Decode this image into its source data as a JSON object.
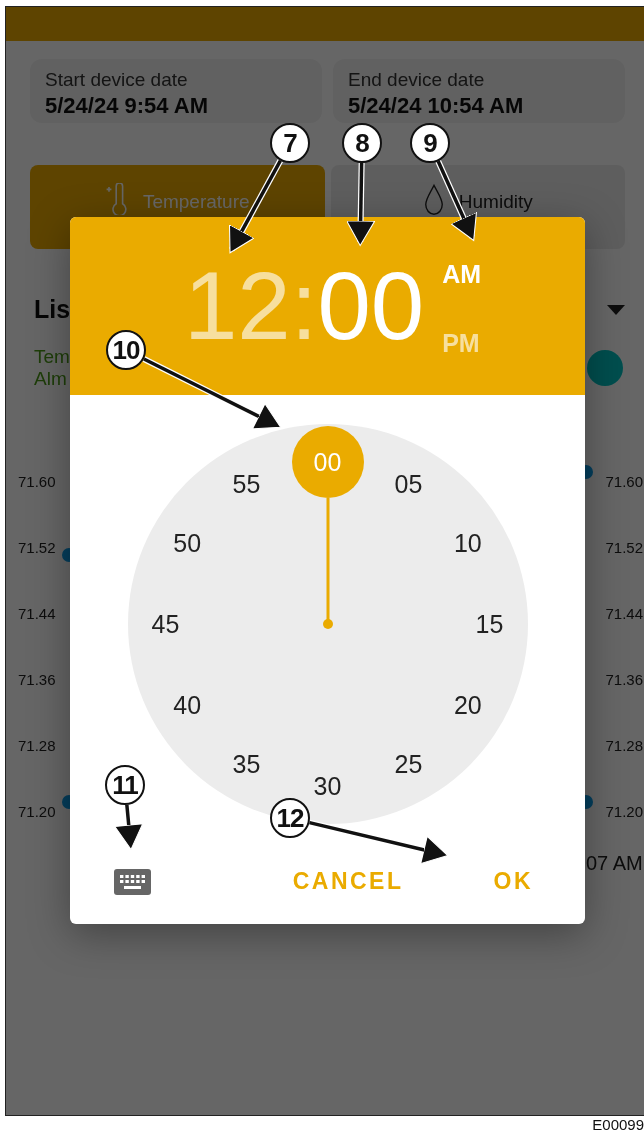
{
  "date_range": [
    {
      "label": "Start device date",
      "value": "5/24/24 9:54 AM"
    },
    {
      "label": "End device date",
      "value": "5/24/24 10:54 AM"
    }
  ],
  "tabs": [
    {
      "label": "Temperature",
      "selected": true
    },
    {
      "label": "Humidity",
      "selected": false
    }
  ],
  "section_title": "Lis",
  "legend": [
    "Tem",
    "Alm"
  ],
  "chart": {
    "left_axis": [
      "71.60",
      "71.52",
      "71.44",
      "71.36",
      "71.28",
      "71.20"
    ],
    "right_axis": [
      "71.60",
      "71.52",
      "71.44",
      "71.36",
      "71.28",
      "71.20"
    ],
    "x_label": "07 AM"
  },
  "time_picker": {
    "hour": {
      "text": "12",
      "selected": false
    },
    "separator": ":",
    "minute": {
      "text": "00",
      "selected": true
    },
    "periods": [
      {
        "label": "AM",
        "selected": true
      },
      {
        "label": "PM",
        "selected": false
      }
    ],
    "dial": [
      {
        "label": "00",
        "selected": true
      },
      {
        "label": "05",
        "selected": false
      },
      {
        "label": "10",
        "selected": false
      },
      {
        "label": "15",
        "selected": false
      },
      {
        "label": "20",
        "selected": false
      },
      {
        "label": "25",
        "selected": false
      },
      {
        "label": "30",
        "selected": false
      },
      {
        "label": "35",
        "selected": false
      },
      {
        "label": "40",
        "selected": false
      },
      {
        "label": "45",
        "selected": false
      },
      {
        "label": "50",
        "selected": false
      },
      {
        "label": "55",
        "selected": false
      }
    ],
    "buttons": [
      "CANCEL",
      "OK"
    ]
  },
  "callouts": [
    {
      "number": "7"
    },
    {
      "number": "8"
    },
    {
      "number": "9"
    },
    {
      "number": "10"
    },
    {
      "number": "11"
    },
    {
      "number": "12"
    }
  ],
  "figure_id": "E00099"
}
